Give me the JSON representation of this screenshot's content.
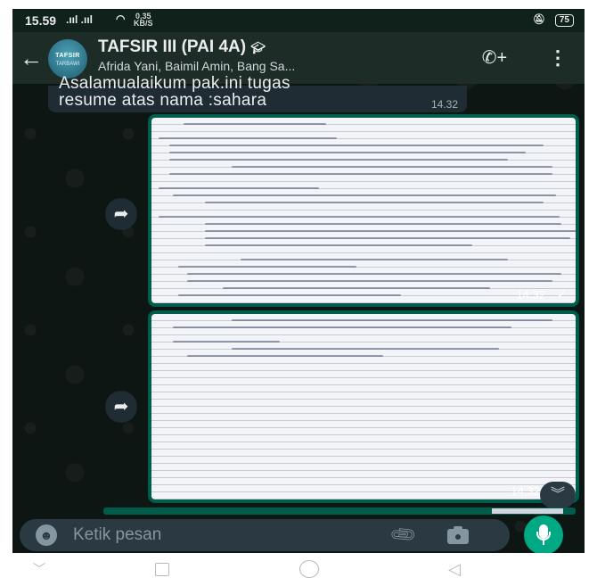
{
  "status_bar": {
    "time": "15.59",
    "signal": ".ııl .ııl",
    "net_speed_value": "0,35",
    "net_speed_unit": "KB/S",
    "battery": "75"
  },
  "header": {
    "group_name": "TAFSIR III (PAI 4A)",
    "members": "Afrida Yani, Baimil Amin, Bang Sa...",
    "avatar_text_line1": "TAFSIR",
    "avatar_text_line2": "TARBAWI",
    "icons": {
      "back": "arrow-left-icon",
      "call": "add-call-icon",
      "menu": "more-vertical-icon"
    }
  },
  "messages": [
    {
      "type": "text",
      "line1": "Asalamualaikum pak.ini tugas",
      "line2": "resume atas nama :sahara",
      "time": "14.32"
    },
    {
      "type": "image",
      "description": "handwritten lined paper page 1",
      "time": "14.32",
      "status": "✓"
    },
    {
      "type": "image",
      "description": "handwritten lined paper page 2",
      "time": "14.32"
    }
  ],
  "composer": {
    "placeholder": "Ketik pesan",
    "icons": {
      "emoji": "emoji-icon",
      "attach": "paperclip-icon",
      "camera": "camera-icon",
      "mic": "microphone-icon"
    }
  },
  "colors": {
    "header_bg": "#1e2c28",
    "bubble_out": "#005c4b",
    "bubble_in": "#202c33",
    "accent": "#00a884"
  }
}
